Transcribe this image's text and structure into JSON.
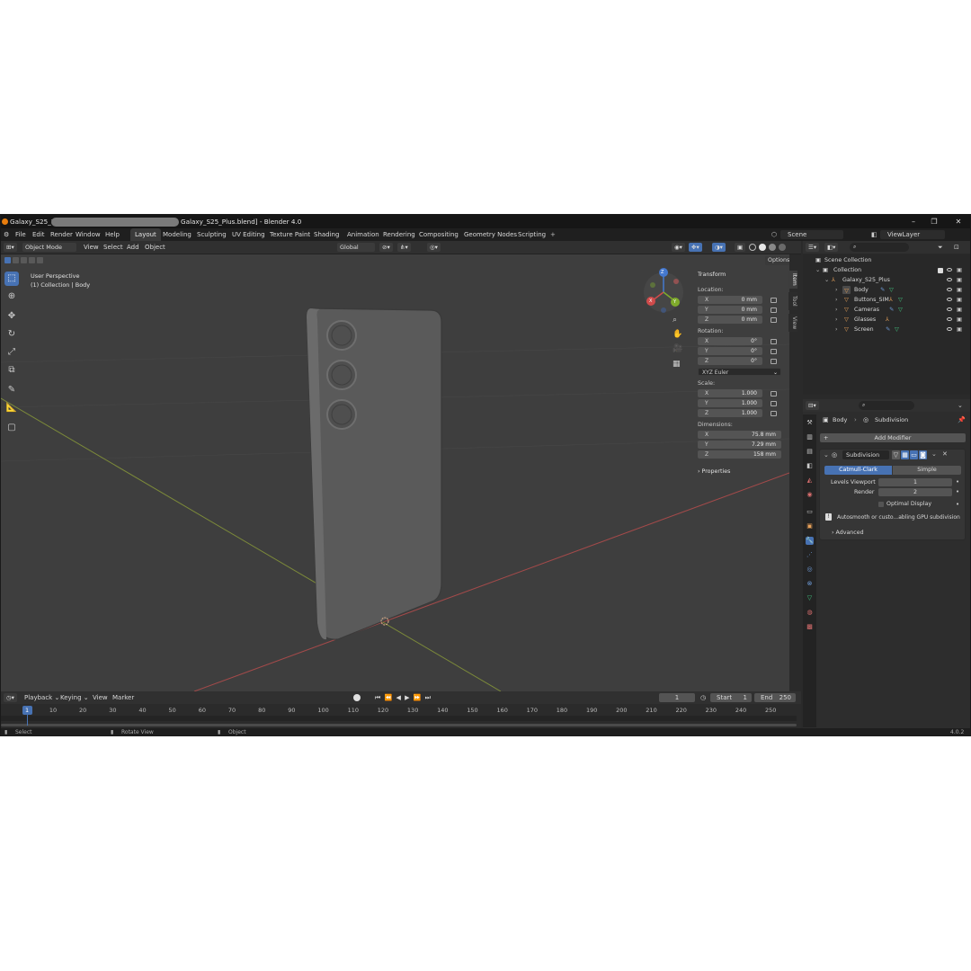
{
  "titlebar": {
    "title_prefix": "Galaxy_S25_Plus",
    "title_suffix": "Galaxy_S25_Plus.blend] - Blender 4.0"
  },
  "menu": {
    "items": [
      "File",
      "Edit",
      "Render",
      "Window",
      "Help"
    ],
    "workspaces": [
      "Layout",
      "Modeling",
      "Sculpting",
      "UV Editing",
      "Texture Paint",
      "Shading",
      "Animation",
      "Rendering",
      "Compositing",
      "Geometry Nodes",
      "Scripting"
    ],
    "add_tab": "+",
    "scene": "Scene",
    "view_layer": "ViewLayer"
  },
  "viewport_header": {
    "mode": "Object Mode",
    "menus": [
      "View",
      "Select",
      "Add",
      "Object"
    ],
    "orientation": "Global",
    "options": "Options"
  },
  "viewport": {
    "perspective": "User Perspective",
    "collection_info": "(1) Collection | Body",
    "gizmo": {
      "x": "X",
      "y": "Y",
      "z": "Z"
    }
  },
  "npanel": {
    "section": "Transform",
    "location_label": "Location:",
    "location": [
      {
        "axis": "X",
        "value": "0 mm"
      },
      {
        "axis": "Y",
        "value": "0 mm"
      },
      {
        "axis": "Z",
        "value": "0 mm"
      }
    ],
    "rotation_label": "Rotation:",
    "rotation": [
      {
        "axis": "X",
        "value": "0°"
      },
      {
        "axis": "Y",
        "value": "0°"
      },
      {
        "axis": "Z",
        "value": "0°"
      }
    ],
    "rotation_mode": "XYZ Euler",
    "scale_label": "Scale:",
    "scale": [
      {
        "axis": "X",
        "value": "1.000"
      },
      {
        "axis": "Y",
        "value": "1.000"
      },
      {
        "axis": "Z",
        "value": "1.000"
      }
    ],
    "dimensions_label": "Dimensions:",
    "dimensions": [
      {
        "axis": "X",
        "value": "75.8 mm"
      },
      {
        "axis": "Y",
        "value": "7.29 mm"
      },
      {
        "axis": "Z",
        "value": "158 mm"
      }
    ],
    "properties": "Properties",
    "side_tabs": [
      "Item",
      "Tool",
      "View"
    ]
  },
  "outliner": {
    "scene_collection": "Scene Collection",
    "collection": "Collection",
    "root_object": "Galaxy_S25_Plus",
    "children": [
      "Body",
      "Buttons_SIM",
      "Cameras",
      "Glasses",
      "Screen"
    ]
  },
  "properties": {
    "breadcrumb_object": "Body",
    "breadcrumb_modifier": "Subdivision",
    "add_modifier": "Add Modifier",
    "modifier_name": "Subdivision",
    "type_catmull": "Catmull-Clark",
    "type_simple": "Simple",
    "levels_viewport_label": "Levels Viewport",
    "levels_viewport": "1",
    "render_label": "Render",
    "render_value": "2",
    "optimal_display": "Optimal Display",
    "warning": "Autosmooth or custo...abling GPU subdivision",
    "advanced": "Advanced"
  },
  "timeline": {
    "menus": [
      "Playback",
      "Keying",
      "View",
      "Marker"
    ],
    "current_frame": "1",
    "start_label": "Start",
    "start": "1",
    "end_label": "End",
    "end": "250",
    "ticks": [
      "1",
      "10",
      "20",
      "30",
      "40",
      "50",
      "60",
      "70",
      "80",
      "90",
      "100",
      "110",
      "120",
      "130",
      "140",
      "150",
      "160",
      "170",
      "180",
      "190",
      "200",
      "210",
      "220",
      "230",
      "240",
      "250"
    ]
  },
  "statusbar": {
    "select": "Select",
    "rotate": "Rotate View",
    "object": "Object",
    "version": "4.0.2"
  }
}
